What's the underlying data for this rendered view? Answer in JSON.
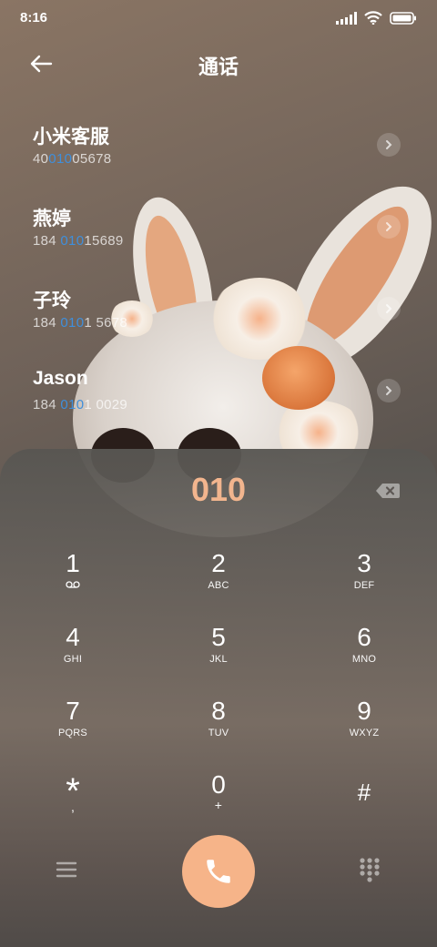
{
  "status": {
    "time": "8:16"
  },
  "header": {
    "title": "通话"
  },
  "contacts": [
    {
      "name": "小米客服",
      "num_pre": "40",
      "num_hl": "010",
      "num_post": "05678"
    },
    {
      "name": "燕婷",
      "num_pre": "184 ",
      "num_hl": "010",
      "num_post": "15689"
    },
    {
      "name": "子玲",
      "num_pre": "184 ",
      "num_hl": "010",
      "num_post": "1 5678"
    },
    {
      "name": "Jason",
      "num_pre": "184 ",
      "num_hl": "010",
      "num_post": "1 0029"
    }
  ],
  "dialer": {
    "display": "010",
    "keys": [
      {
        "digit": "1",
        "letters": ""
      },
      {
        "digit": "2",
        "letters": "ABC"
      },
      {
        "digit": "3",
        "letters": "DEF"
      },
      {
        "digit": "4",
        "letters": "GHI"
      },
      {
        "digit": "5",
        "letters": "JKL"
      },
      {
        "digit": "6",
        "letters": "MNO"
      },
      {
        "digit": "7",
        "letters": "PQRS"
      },
      {
        "digit": "8",
        "letters": "TUV"
      },
      {
        "digit": "9",
        "letters": "WXYZ"
      },
      {
        "digit": "*",
        "letters": ","
      },
      {
        "digit": "0",
        "letters": "+"
      },
      {
        "digit": "#",
        "letters": ""
      }
    ]
  },
  "colors": {
    "accent": "#f6b489",
    "highlight": "#3f8fdc",
    "display": "#f2b58e"
  },
  "icons": [
    "back-arrow-icon",
    "signal-icon",
    "wifi-icon",
    "battery-icon",
    "chevron-right-icon",
    "backspace-icon",
    "voicemail-icon",
    "menu-icon",
    "phone-icon",
    "dialpad-icon"
  ]
}
